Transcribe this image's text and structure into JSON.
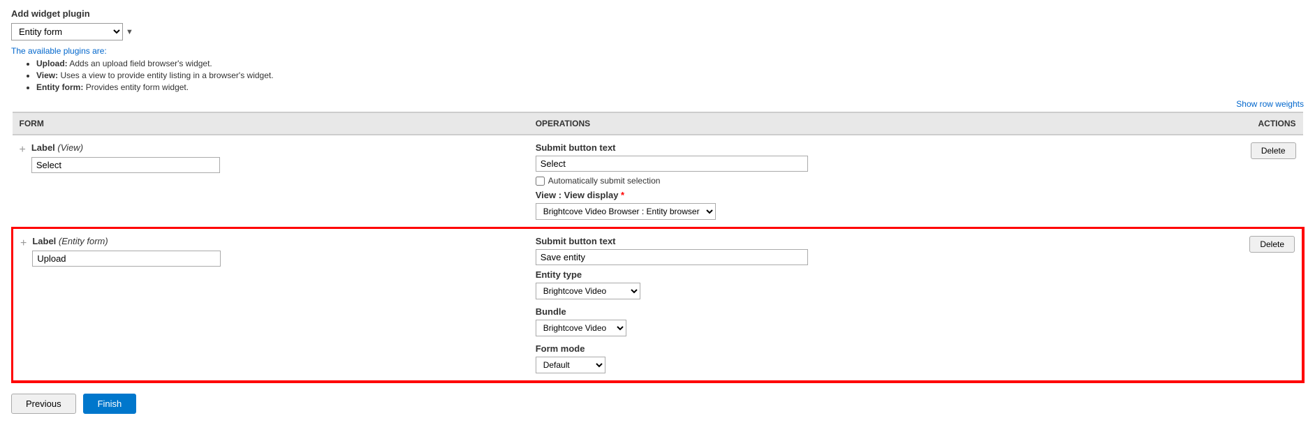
{
  "page": {
    "add_widget_title": "Add widget plugin",
    "plugin_select_value": "Entity form",
    "available_plugins_label": "The available plugins are:",
    "plugin_list": [
      {
        "name": "Upload:",
        "description": "Adds an upload field browser's widget."
      },
      {
        "name": "View:",
        "description": "Uses a view to provide entity listing in a browser's widget."
      },
      {
        "name": "Entity form:",
        "description": "Provides entity form widget."
      }
    ],
    "show_row_weights": "Show row weights",
    "table": {
      "headers": {
        "form": "FORM",
        "operations": "OPERATIONS",
        "actions": "ACTIONS"
      },
      "rows": [
        {
          "id": "row1",
          "label": "Label",
          "label_type": "View",
          "input_value": "Select",
          "submit_button_text_label": "Submit button text",
          "submit_button_text_value": "Select",
          "auto_submit_label": "Automatically submit selection",
          "view_display_label": "View : View display",
          "view_display_required": true,
          "view_display_options": [
            "Brightcove Video Browser : Entity browser"
          ],
          "view_display_selected": "Brightcove Video Browser : Entity browser",
          "delete_label": "Delete",
          "highlighted": false
        },
        {
          "id": "row2",
          "label": "Label",
          "label_type": "Entity form",
          "input_value": "Upload",
          "submit_button_text_label": "Submit button text",
          "submit_button_text_value": "Save entity",
          "entity_type_label": "Entity type",
          "entity_type_options": [
            "Brightcove Video"
          ],
          "entity_type_selected": "Brightcove Video",
          "bundle_label": "Bundle",
          "bundle_options": [
            "Brightcove Video"
          ],
          "bundle_selected": "Brightcove Video",
          "form_mode_label": "Form mode",
          "form_mode_options": [
            "Default"
          ],
          "form_mode_selected": "Default",
          "delete_label": "Delete",
          "highlighted": true
        }
      ]
    },
    "footer": {
      "previous_label": "Previous",
      "finish_label": "Finish"
    }
  }
}
